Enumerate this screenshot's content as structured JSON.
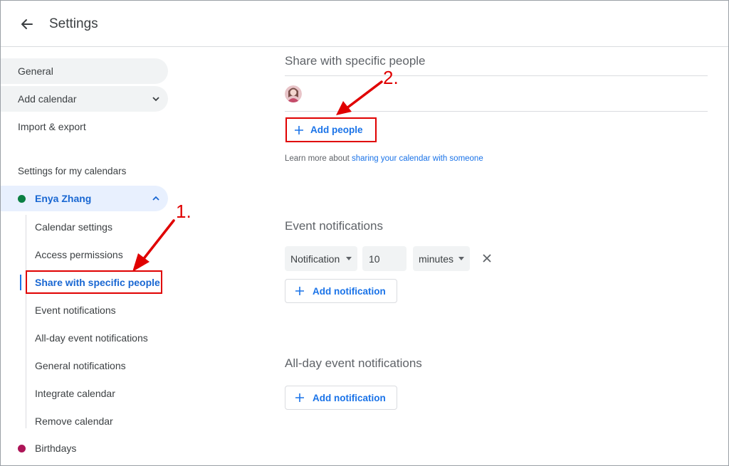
{
  "header": {
    "title": "Settings",
    "back_icon": "arrow-left-icon"
  },
  "sidebar": {
    "top_items": [
      {
        "label": "General"
      },
      {
        "label": "Add calendar"
      },
      {
        "label": "Import & export"
      }
    ],
    "section_heading": "Settings for my calendars",
    "calendars": [
      {
        "name": "Enya Zhang",
        "color": "#0b8043",
        "sub_items": [
          {
            "label": "Calendar settings"
          },
          {
            "label": "Access permissions"
          },
          {
            "label": "Share with specific people"
          },
          {
            "label": "Event notifications"
          },
          {
            "label": "All-day event notifications"
          },
          {
            "label": "General notifications"
          },
          {
            "label": "Integrate calendar"
          },
          {
            "label": "Remove calendar"
          }
        ]
      },
      {
        "name": "Birthdays",
        "color": "#ad1457"
      }
    ]
  },
  "main": {
    "share": {
      "title": "Share with specific people",
      "add_people_label": "Add people",
      "learn_prefix": "Learn more about ",
      "learn_link": "sharing your calendar with someone"
    },
    "event_notifications": {
      "title": "Event notifications",
      "type_value": "Notification",
      "amount_value": "10",
      "unit_value": "minutes",
      "add_label": "Add notification"
    },
    "allday_notifications": {
      "title": "All-day event notifications",
      "add_label": "Add notification"
    }
  },
  "annotations": {
    "step1": "1.",
    "step2": "2.",
    "color": "#e00000"
  },
  "colors": {
    "accent": "#1a73e8",
    "selected_bg": "#e8f0fe",
    "text": "#3c4043"
  }
}
